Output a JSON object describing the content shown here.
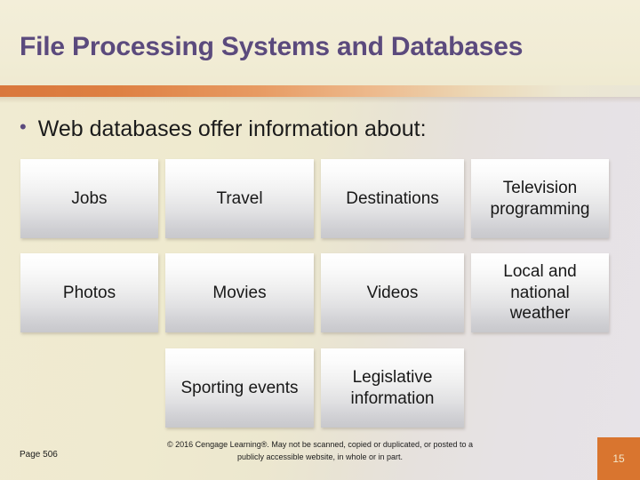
{
  "slide": {
    "title": "File Processing Systems and Databases",
    "bullet_marker": "•",
    "bullet_text": "Web databases offer information about:",
    "title_color": "#5b4a7d",
    "accent_color": "#d9773c",
    "badge_color": "#d9752f",
    "background_left_color": "#f0ebd2",
    "background_right_color": "#e7e3e8"
  },
  "grid": {
    "rows": [
      {
        "boxes": [
          {
            "label": "Jobs"
          },
          {
            "label": "Travel"
          },
          {
            "label": "Destinations"
          },
          {
            "label": "Television programming"
          }
        ]
      },
      {
        "boxes": [
          {
            "label": "Photos"
          },
          {
            "label": "Movies"
          },
          {
            "label": "Videos"
          },
          {
            "label": "Local and national weather"
          }
        ]
      },
      {
        "boxes": [
          {
            "label": "Sporting events"
          },
          {
            "label": "Legislative information"
          }
        ]
      }
    ]
  },
  "footer": {
    "page_reference": "Page 506",
    "copyright": "© 2016 Cengage Learning®. May not be scanned, copied or duplicated, or posted to a publicly accessible website, in whole or in part.",
    "slide_number": "15"
  }
}
